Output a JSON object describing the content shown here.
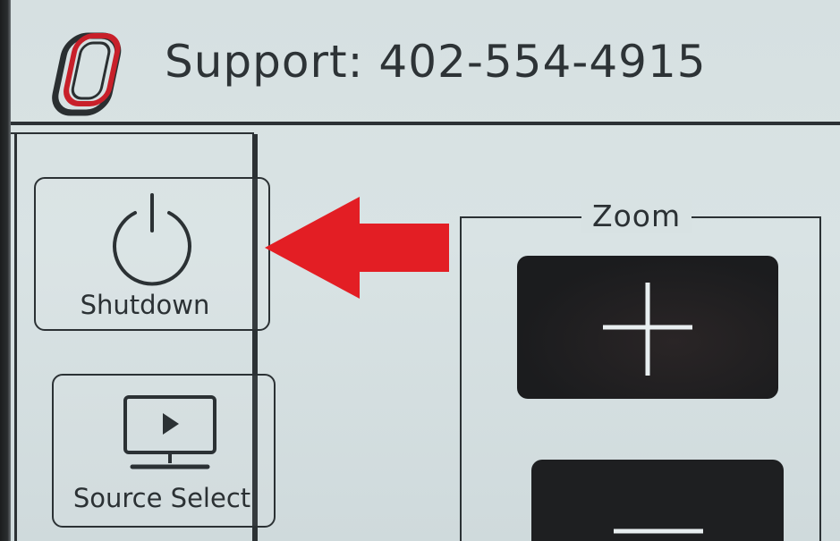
{
  "header": {
    "logo_icon": "university-logo-icon",
    "support_text": "Support: 402-554-4915"
  },
  "sidebar": {
    "items": [
      {
        "label": "Shutdown",
        "icon": "power-icon"
      },
      {
        "label": "Source Select",
        "icon": "monitor-play-icon"
      }
    ]
  },
  "annotation": {
    "icon": "red-arrow-left-icon",
    "color": "#e31e24"
  },
  "zoom": {
    "title": "Zoom",
    "in_icon": "plus-icon",
    "out_icon": "minus-icon"
  },
  "colors": {
    "background": "#d8e2e3",
    "foreground": "#2b3134",
    "button_dark": "#1e1f21",
    "logo_red": "#c8202a"
  }
}
